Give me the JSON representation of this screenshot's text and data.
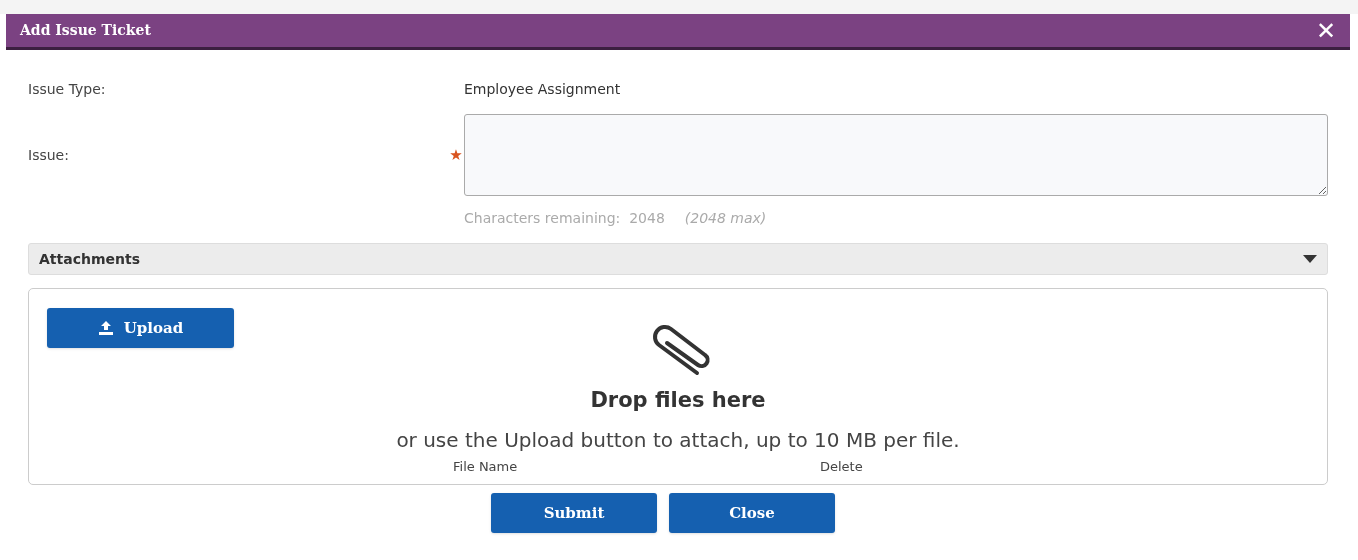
{
  "dialog": {
    "title": "Add Issue Ticket",
    "close_label": "✕"
  },
  "fields": [
    {
      "kind": "text",
      "label": "Issue Type:",
      "value": "Employee Assignment"
    },
    {
      "kind": "textarea",
      "label": "Issue:",
      "required": true,
      "required_mark": "★",
      "counter_label": "Characters remaining:",
      "counter_value": "2048",
      "counter_max": "(2048 max)"
    }
  ],
  "attachments": {
    "title": "Attachments",
    "expanded": true,
    "upload_button": "Upload",
    "drop_title": "Drop files here",
    "drop_hint": "or use the Upload button to attach, up to 10 MB per file.",
    "columns": [
      "File Name",
      "Delete"
    ]
  },
  "buttons": [
    "Submit",
    "Close"
  ]
}
